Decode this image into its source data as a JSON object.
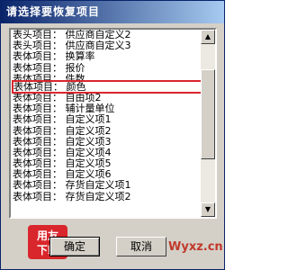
{
  "dialog": {
    "title": "请选择要恢复项目",
    "ok_label": "确定",
    "cancel_label": "取消",
    "watermark": "Wyxz.cn",
    "logo_text": [
      "用友",
      "下载"
    ]
  },
  "list": {
    "items": [
      "表头项目：  供应商自定义2",
      "表头项目：  供应商自定义3",
      "表体项目：  换算率",
      "表体项目：  报价",
      "表体项目：  件数",
      "表体项目：  颜色",
      "表体项目：  自由项2",
      "表体项目：  辅计量单位",
      "表体项目：  自定义项1",
      "表体项目：  自定义项2",
      "表体项目：  自定义项3",
      "表体项目：  自定义项4",
      "表体项目：  自定义项5",
      "表体项目：  自定义项6",
      "表体项目：  存货自定义项1",
      "表体项目：  存货自定义项2"
    ],
    "highlighted_index": 5
  },
  "colors": {
    "highlight_border": "#d9262c",
    "title_gradient_start": "#0a246a",
    "title_gradient_end": "#a6caf0"
  }
}
